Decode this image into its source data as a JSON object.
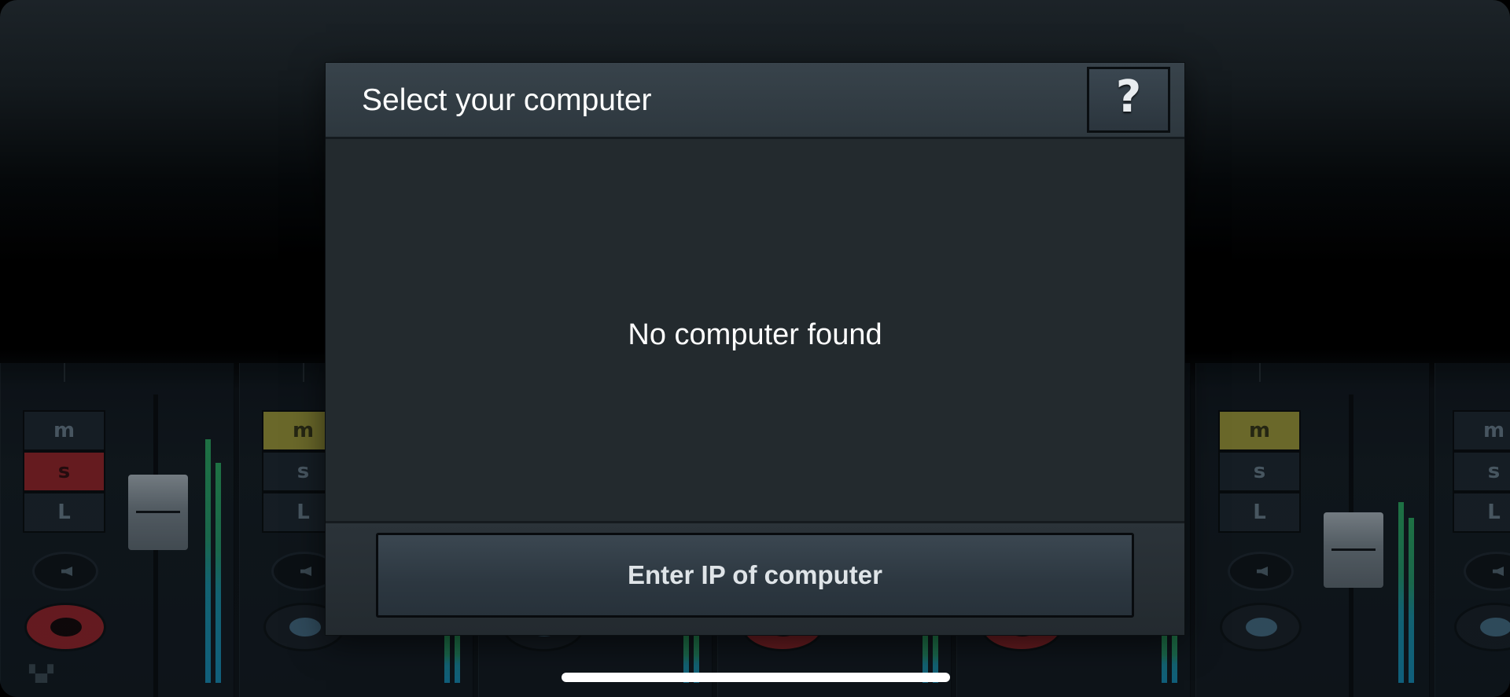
{
  "dialog": {
    "title": "Select your computer",
    "help_label": "?",
    "empty_message": "No computer found",
    "enter_ip_label": "Enter IP of computer"
  },
  "mixer": {
    "mute_label": "m",
    "solo_label": "s",
    "listen_label": "L",
    "icon_names": [
      "speaker-icon",
      "record-icon",
      "presonus-logo-icon"
    ],
    "colors": {
      "mute_active": "#b9b23e",
      "solo_active": "#b0262a",
      "record_armed": "#b0262a",
      "meter_green": "#2fc26b",
      "meter_blue": "#16a0d0"
    }
  },
  "colors": {
    "dialog_background": "#22292e",
    "header_background": "#38434b",
    "text": "#ffffff"
  }
}
